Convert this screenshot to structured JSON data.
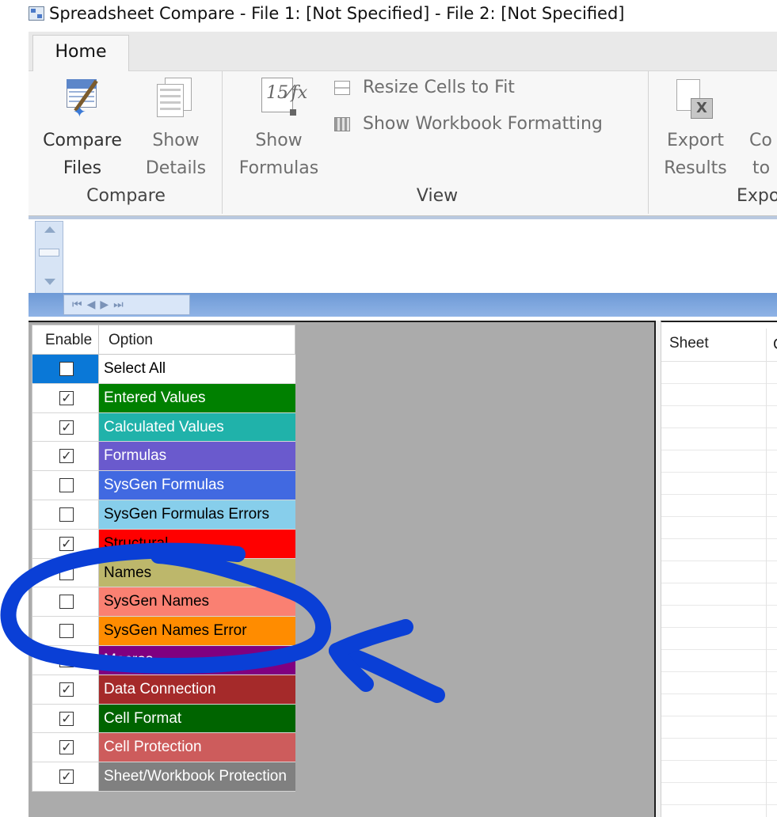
{
  "window": {
    "title": "Spreadsheet Compare - File 1: [Not Specified] - File 2: [Not Specified]"
  },
  "ribbon": {
    "tabs": [
      "Home"
    ],
    "compare_files": [
      "Compare",
      "Files"
    ],
    "show_details": [
      "Show",
      "Details"
    ],
    "group_compare": "Compare",
    "show_formulas": [
      "Show",
      "Formulas"
    ],
    "resize_cells": "Resize Cells to Fit",
    "show_workbook_formatting": "Show Workbook Formatting",
    "group_view": "View",
    "export_results": [
      "Export",
      "Results"
    ],
    "copy_to_partial": [
      "Co",
      "to"
    ],
    "group_export_partial": "Expo"
  },
  "options": {
    "headers": [
      "Enable",
      "Option"
    ],
    "rows": [
      {
        "label": "Select All",
        "checked": false,
        "bg": "#ffffff",
        "fg": "#000000",
        "selected": true
      },
      {
        "label": "Entered Values",
        "checked": true,
        "bg": "#008000",
        "fg": "#ffffff"
      },
      {
        "label": "Calculated Values",
        "checked": true,
        "bg": "#20b2aa",
        "fg": "#ffffff"
      },
      {
        "label": "Formulas",
        "checked": true,
        "bg": "#6a5acd",
        "fg": "#ffffff"
      },
      {
        "label": "SysGen Formulas",
        "checked": false,
        "bg": "#4169e1",
        "fg": "#ffffff"
      },
      {
        "label": "SysGen Formulas Errors",
        "checked": false,
        "bg": "#87ceeb",
        "fg": "#000000"
      },
      {
        "label": "Structural",
        "checked": true,
        "bg": "#ff0000",
        "fg": "#000000"
      },
      {
        "label": "Names",
        "checked": false,
        "bg": "#bdb76b",
        "fg": "#000000"
      },
      {
        "label": "SysGen Names",
        "checked": false,
        "bg": "#fa8072",
        "fg": "#000000"
      },
      {
        "label": "SysGen Names Error",
        "checked": false,
        "bg": "#ff8c00",
        "fg": "#000000"
      },
      {
        "label": "Macros",
        "checked": true,
        "bg": "#800080",
        "fg": "#ffffff"
      },
      {
        "label": "Data Connection",
        "checked": true,
        "bg": "#a52a2a",
        "fg": "#ffffff"
      },
      {
        "label": "Cell Format",
        "checked": true,
        "bg": "#006400",
        "fg": "#ffffff"
      },
      {
        "label": "Cell Protection",
        "checked": true,
        "bg": "#cd5c5c",
        "fg": "#ffffff"
      },
      {
        "label": "Sheet/Workbook Protection",
        "checked": true,
        "bg": "#808080",
        "fg": "#ffffff"
      }
    ]
  },
  "results": {
    "headers": [
      "Sheet",
      "C"
    ]
  },
  "colors": {
    "annotation_blue": "#0a3fd6",
    "selection_blue": "#0a78d7"
  }
}
